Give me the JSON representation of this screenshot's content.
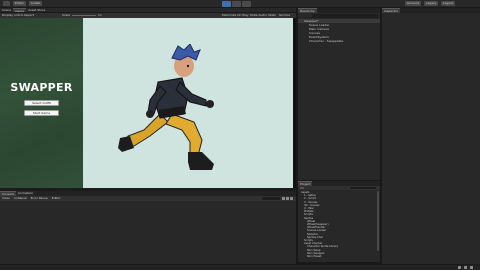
{
  "toolbar": {
    "left_menus": [
      "",
      "Editor",
      "Collab"
    ],
    "center_items": [
      "Play",
      "Pause",
      "Step"
    ],
    "right_items": [
      "Account",
      "Layers",
      "Layout"
    ]
  },
  "scene_tabs": {
    "tabs": [
      "Scene",
      "Game",
      "Asset Store"
    ]
  },
  "scene_toolbar": {
    "display": "Display 1",
    "aspect": "16:9 Aspect",
    "scale_label": "Scale",
    "scale_value": "1x",
    "maximize": "Maximize On Play",
    "mute": "Mute Audio",
    "stats": "Stats",
    "gizmos": "Gizmos"
  },
  "game_view": {
    "title": "SWAPPER",
    "buttons": [
      "Select Outfit",
      "Start Game"
    ]
  },
  "hierarchy": {
    "tab": "Hierarchy",
    "items": [
      "Swapper*",
      "Scene Loader",
      "Main Camera",
      "Canvas",
      "EventSystem",
      "Character - Swappable"
    ]
  },
  "inspector": {
    "tab": "Inspector"
  },
  "bottom_left": {
    "tabs": [
      "Console",
      "Animation"
    ],
    "toolbar": [
      "Clear",
      "Collapse",
      "Error Pause",
      "Editor"
    ]
  },
  "project": {
    "tab": "Project",
    "items": [
      "Assets",
      "1 - Setup",
      "2 - Script",
      "3 - Scenes",
      "3D - Scenes",
      "4 - Misc",
      "Prefabs",
      "Scripts",
      "Sprites",
      "Wheel",
      "Wheel(Swapper)",
      "WheelHandler",
      "Scenes-Loader",
      "Skeleton",
      "Sprites-Char",
      "Scripts",
      "Asset Checker",
      "Character Sprite Library",
      "Skin Swap",
      "Skin Swapper",
      "Skin Preset"
    ]
  },
  "status": {
    "items": [
      "",
      "",
      ""
    ]
  }
}
